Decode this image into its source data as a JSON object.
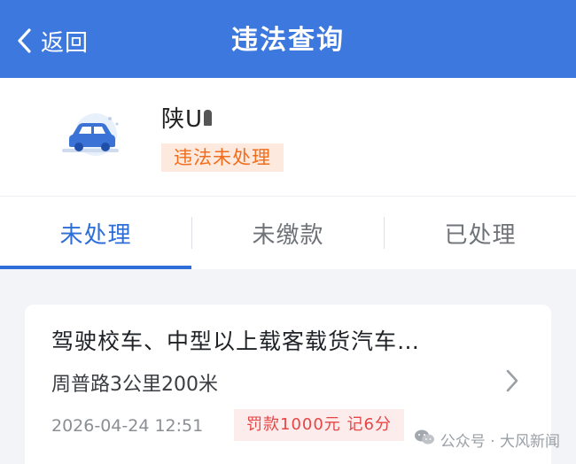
{
  "header": {
    "back_label": "返回",
    "title": "违法查询"
  },
  "vehicle": {
    "plate": "陕U",
    "status": "违法未处理"
  },
  "tabs": [
    {
      "label": "未处理",
      "active": true
    },
    {
      "label": "未缴款",
      "active": false
    },
    {
      "label": "已处理",
      "active": false
    }
  ],
  "record": {
    "title": "驾驶校车、中型以上载客载货汽车…",
    "location": "周普路3公里200米",
    "time": "2026-04-24 12:51",
    "penalty": "罚款1000元 记6分"
  },
  "watermark": "公众号 · 大风新闻",
  "colors": {
    "header": "#3c78dd",
    "accent": "#2e6ed8",
    "status_text": "#f06d1e",
    "penalty_text": "#e54545"
  }
}
